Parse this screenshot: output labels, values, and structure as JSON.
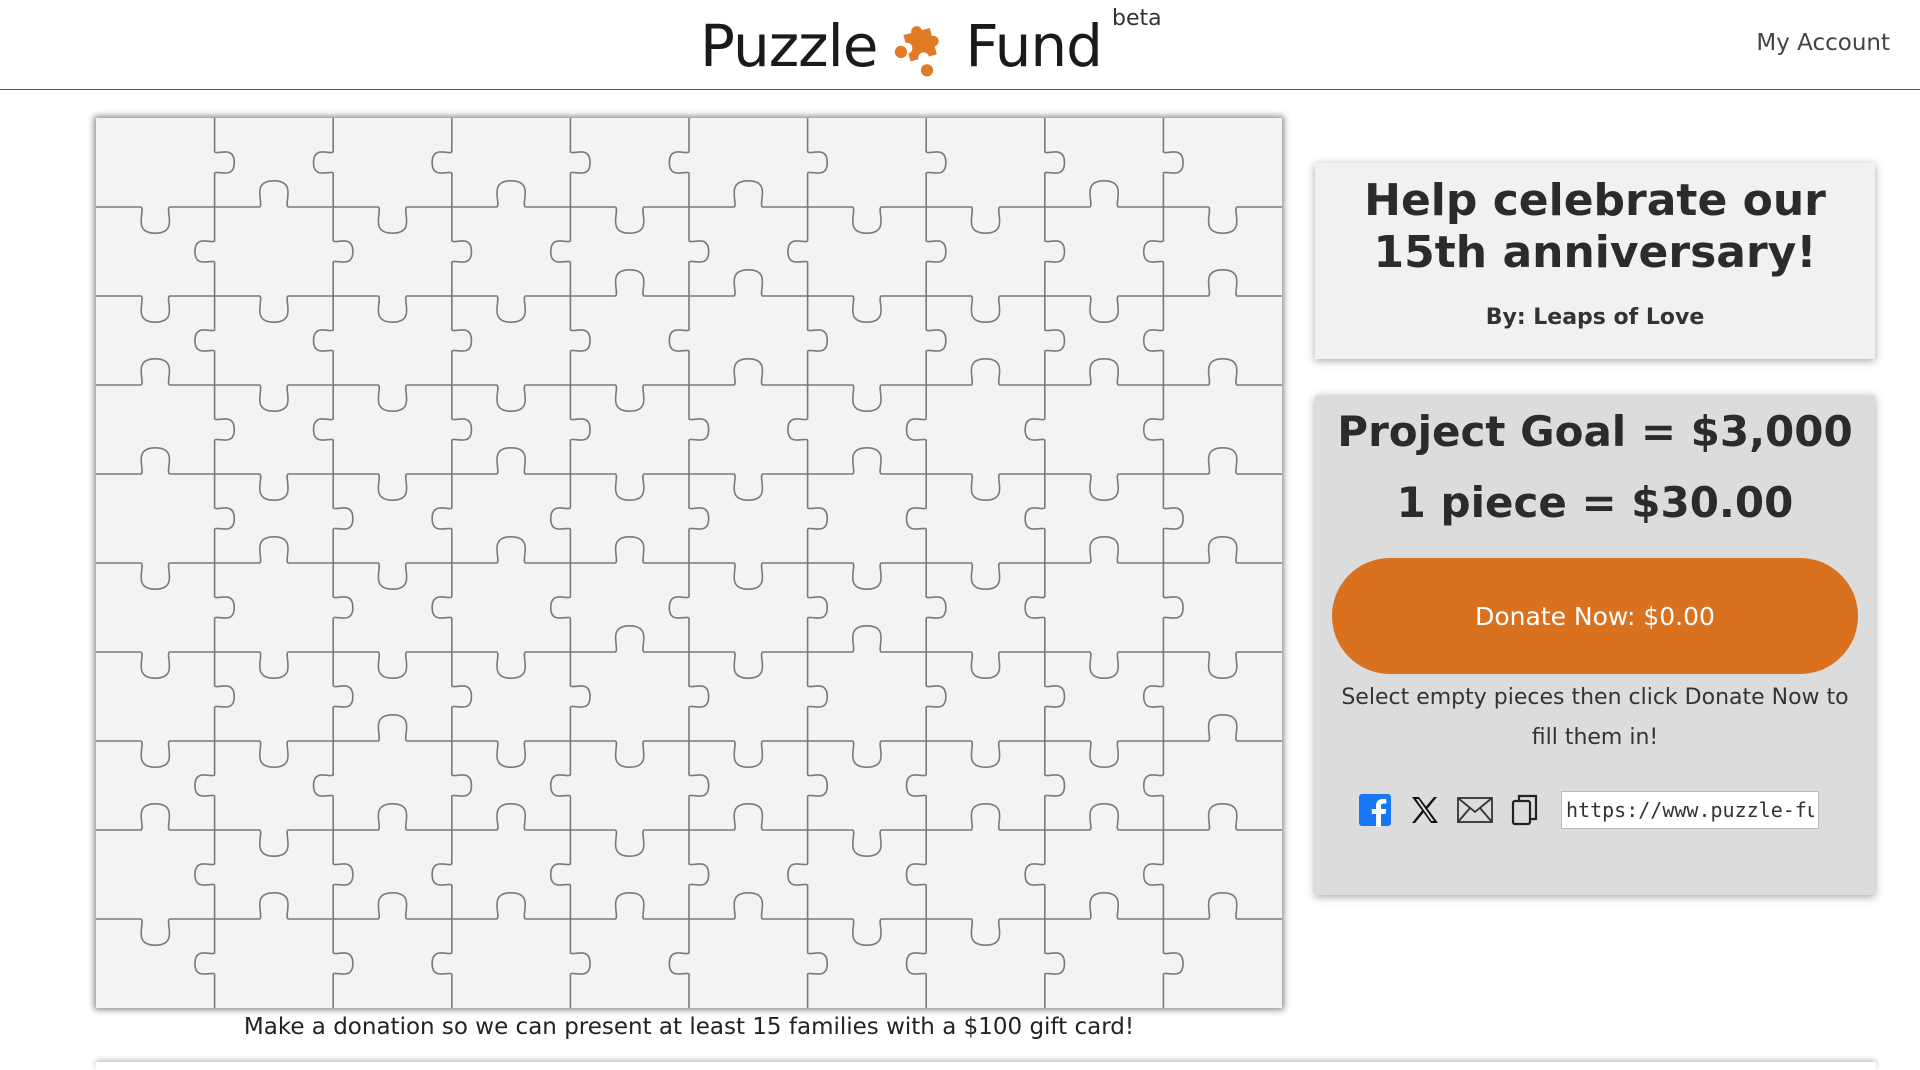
{
  "header": {
    "logo_left": "Puzzle",
    "logo_right": "Fund",
    "logo_beta": "beta",
    "my_account": "My Account",
    "brand_color": "#e07a24"
  },
  "project": {
    "title": "Help celebrate our 15th anniversary!",
    "byline": "By: Leaps of Love",
    "caption": "Make a donation so we can present at least 15 families with a $100 gift card!"
  },
  "goal": {
    "goal_text": "Project Goal = $3,000",
    "piece_text": "1 piece = $30.00",
    "donate_label": "Donate Now: $0.00",
    "donate_color": "#d9711f",
    "instructions": "Select empty pieces then click Donate Now to fill them in!"
  },
  "share": {
    "icons": [
      "facebook-icon",
      "x-icon",
      "email-icon",
      "copy-icon"
    ],
    "url_value": "https://www.puzzle-fun"
  },
  "puzzle": {
    "columns": 10,
    "rows": 10,
    "total_pieces": 100
  }
}
